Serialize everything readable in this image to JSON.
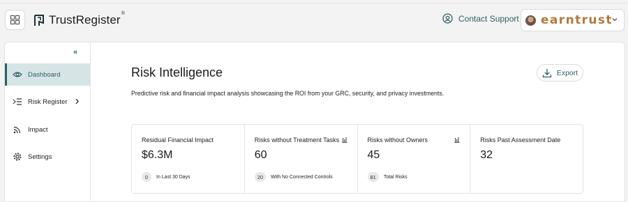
{
  "header": {
    "logo_text": "TrustRegister",
    "logo_mark": "®",
    "support_label": "Contact Support",
    "account_brand": "earntrust",
    "icons": {
      "apps": "grid-icon",
      "support": "headset-icon",
      "menu": "chevron-down-icon"
    }
  },
  "sidebar": {
    "collapse_icon": "«",
    "items": [
      {
        "label": "Dashboard",
        "icon": "eye-icon",
        "active": true
      },
      {
        "label": "Risk Register",
        "icon": "list-indent-icon",
        "active": false,
        "has_submenu": true
      },
      {
        "label": "Impact",
        "icon": "signal-icon",
        "active": false
      },
      {
        "label": "Settings",
        "icon": "gear-icon",
        "active": false
      }
    ]
  },
  "main": {
    "title": "Risk Intelligence",
    "description": "Predictive risk and financial impact analysis showcasing the ROI from your GRC, security, and privacy investments.",
    "export_label": "Export",
    "cards": [
      {
        "title": "Residual Financial Impact",
        "value": "$6.3M",
        "pill": "0",
        "foot": "In Last 30 Days",
        "has_chart_icon": false
      },
      {
        "title": "Risks without Treatment Tasks",
        "value": "60",
        "pill": "20",
        "foot": "With No Connected Controls",
        "has_chart_icon": true
      },
      {
        "title": "Risks without Owners",
        "value": "45",
        "pill": "81",
        "foot": "Total Risks",
        "has_chart_icon": true
      },
      {
        "title": "Risks Past Assessment Date",
        "value": "32",
        "pill": "",
        "foot": "",
        "has_chart_icon": false
      }
    ]
  },
  "colors": {
    "accent": "#2c5f67",
    "active_bg": "#d7e4e6",
    "brand": "#b07a3e"
  }
}
